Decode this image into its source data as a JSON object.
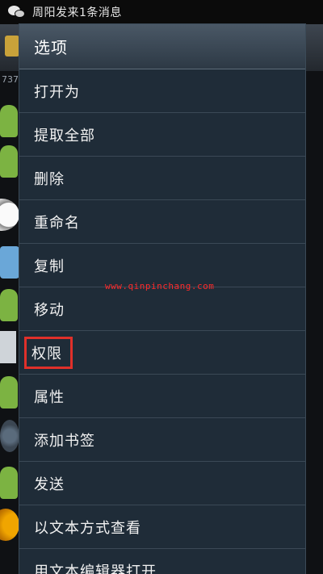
{
  "status_bar": {
    "notification": "周阳发来1条消息"
  },
  "background": {
    "path_fragment": "737"
  },
  "dialog": {
    "title": "选项",
    "items": [
      {
        "label": "打开为"
      },
      {
        "label": "提取全部"
      },
      {
        "label": "删除"
      },
      {
        "label": "重命名"
      },
      {
        "label": "复制"
      },
      {
        "label": "移动"
      },
      {
        "label": "权限",
        "highlighted": true
      },
      {
        "label": "属性"
      },
      {
        "label": "添加书签"
      },
      {
        "label": "发送"
      },
      {
        "label": "以文本方式查看"
      },
      {
        "label": "用文本编辑器打开"
      }
    ]
  },
  "watermark": "www.qinpinchang.com",
  "colors": {
    "dialog_bg": "#1f2c38",
    "header_bg": "#4a5866",
    "highlight_border": "#e0302a",
    "watermark": "#ff2a2a"
  }
}
